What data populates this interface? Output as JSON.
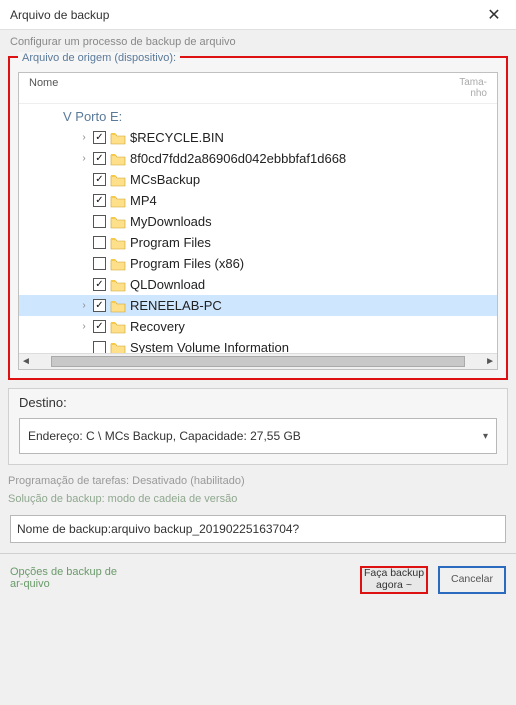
{
  "window": {
    "title": "Arquivo de backup",
    "subtitle": "Configurar um processo de backup de arquivo"
  },
  "source": {
    "legend": "Arquivo de origem (dispositivo):",
    "col_name": "Nome",
    "col_size": "Tama-\nnho",
    "root": "V Porto E:",
    "items": [
      {
        "label": "$RECYCLE.BIN",
        "checked": true,
        "expandable": true
      },
      {
        "label": "8f0cd7fdd2a86906d042ebbbfaf1d668",
        "checked": true,
        "expandable": true
      },
      {
        "label": "MCsBackup",
        "checked": true,
        "expandable": false
      },
      {
        "label": "MP4",
        "checked": true,
        "expandable": false
      },
      {
        "label": "MyDownloads",
        "checked": false,
        "expandable": false
      },
      {
        "label": "Program Files",
        "checked": false,
        "expandable": false
      },
      {
        "label": "Program Files (x86)",
        "checked": false,
        "expandable": false
      },
      {
        "label": "QLDownload",
        "checked": true,
        "expandable": false
      },
      {
        "label": "RENEELAB-PC",
        "checked": true,
        "expandable": true,
        "highlight": true
      },
      {
        "label": "Recovery",
        "checked": true,
        "expandable": true
      },
      {
        "label": "System Volume Information",
        "checked": false,
        "expandable": false
      }
    ]
  },
  "destination": {
    "label": "Destino:",
    "value": "Endereço: C \\ MCs Backup, Capacidade: 27,55 GB"
  },
  "schedule": "Programação de tarefas: Desativado (habilitado)",
  "solution": "Solução de backup: modo de cadeia de versão",
  "backup_name": {
    "label": "Nome de backup: ",
    "value": "arquivo backup_20190225163704?"
  },
  "footer": {
    "options_link": "Opções de backup de ar-quivo",
    "primary_btn": "Faça backup agora ~",
    "cancel_btn": "Cancelar"
  }
}
